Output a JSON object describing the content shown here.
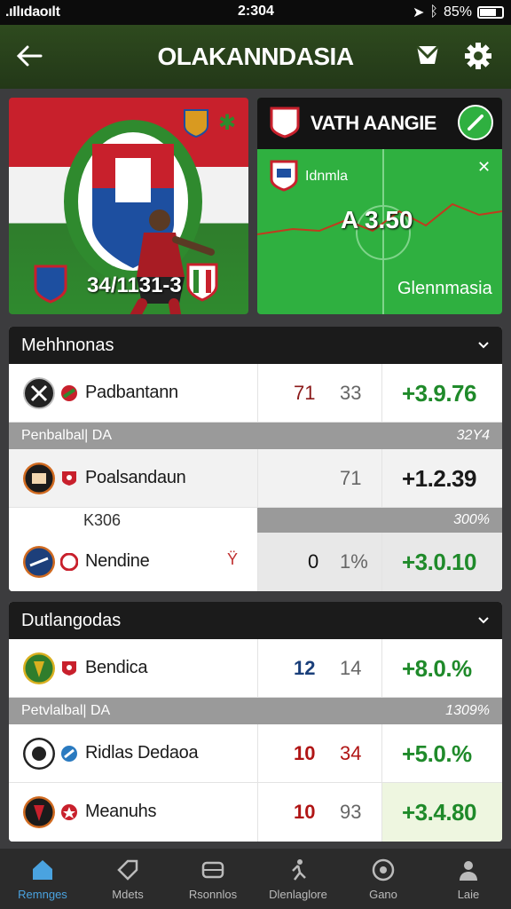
{
  "status_bar": {
    "carrier": ".ıIlıdaoılt",
    "time": "2:304",
    "battery": "85%"
  },
  "header": {
    "title": "OLAKANNDASIA"
  },
  "hero_left": {
    "score_text": "34/1131-3"
  },
  "hero_right": {
    "label": "VATH AANGIE",
    "team": "Idnmla",
    "odd": "A 3.50",
    "league": "Glennmasia"
  },
  "section1": {
    "title": "Mehhnonas",
    "rows": [
      {
        "name": "Padbantann",
        "score1": "71",
        "score2": "33",
        "odd": "+3.9.76",
        "score1_color": "#8b1a1a"
      }
    ],
    "sub_left": "Penbalbal| DA",
    "sub_right": "32Y4",
    "rows2": [
      {
        "name": "Poalsandaun",
        "score1": "",
        "score2": "71",
        "odd": "+1.2.39",
        "odd_prefix_color": "#c9b000"
      }
    ],
    "mid_label": "K306",
    "mid_right": "300%",
    "rows3": [
      {
        "name": "Nendine",
        "mark": "Ÿ",
        "score1": "0",
        "score2": "1%",
        "odd": "+3.0.10"
      }
    ]
  },
  "section2": {
    "title": "Dutlangodas",
    "rows": [
      {
        "name": "Bendica",
        "score1": "12",
        "score2": "14",
        "odd": "+8.0.%",
        "score1_color": "#1a3f7a"
      }
    ],
    "sub_left": "Petvlalbal| DA",
    "sub_right": "1309%",
    "rows2": [
      {
        "name": "Ridlas Dedaoa",
        "score1": "10",
        "score2": "34",
        "odd": "+5.0.%",
        "score1_color": "#b01515",
        "score2_color": "#b01515"
      },
      {
        "name": "Meanuhs",
        "score1": "10",
        "score2": "93",
        "odd": "+3.4.80",
        "score1_color": "#b01515"
      }
    ]
  },
  "tabs": [
    {
      "label": "Remnges",
      "icon": "home-icon",
      "active": true
    },
    {
      "label": "Mdets",
      "icon": "tag-icon",
      "active": false
    },
    {
      "label": "Rsonnlos",
      "icon": "stadium-icon",
      "active": false
    },
    {
      "label": "Dlenlaglore",
      "icon": "player-icon",
      "active": false
    },
    {
      "label": "Gano",
      "icon": "ball-icon",
      "active": false
    },
    {
      "label": "Laie",
      "icon": "user-icon",
      "active": false
    }
  ],
  "colors": {
    "accent_green": "#1f8a2a",
    "header_green": "#2e4a1e",
    "tab_active": "#4aa3e0"
  }
}
